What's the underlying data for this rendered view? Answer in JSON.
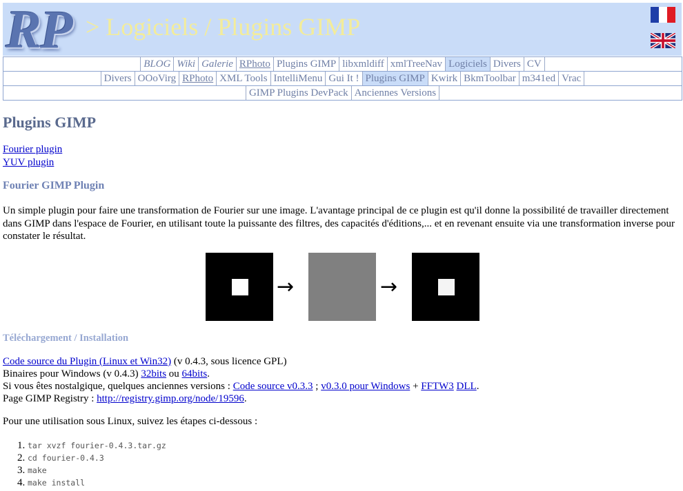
{
  "header": {
    "logo": "RP",
    "title": "> Logiciels / Plugins GIMP",
    "flags": [
      "flag-fr",
      "flag-uk"
    ],
    "colors": {
      "banner": "#c9dcf8",
      "title": "#f3ec9a",
      "logo": "#5a74b0"
    }
  },
  "nav": {
    "row1": [
      {
        "label": "BLOG",
        "italic": true
      },
      {
        "label": "Wiki",
        "italic": true
      },
      {
        "label": "Galerie",
        "italic": true
      },
      {
        "label": "RPhoto",
        "underline": true
      },
      {
        "label": "Plugins GIMP"
      },
      {
        "label": "libxmldiff"
      },
      {
        "label": "xmlTreeNav"
      },
      {
        "label": "Logiciels",
        "active": true
      },
      {
        "label": "Divers"
      },
      {
        "label": "CV"
      }
    ],
    "row2": [
      {
        "label": "Divers"
      },
      {
        "label": "OOoVirg"
      },
      {
        "label": "RPhoto",
        "underline": true
      },
      {
        "label": "XML Tools"
      },
      {
        "label": "IntelliMenu"
      },
      {
        "label": "Gui It !"
      },
      {
        "label": "Plugins GIMP",
        "active": true
      },
      {
        "label": "Kwirk"
      },
      {
        "label": "BkmToolbar"
      },
      {
        "label": "m341ed"
      },
      {
        "label": "Vrac"
      }
    ],
    "row3": [
      {
        "label": "GIMP Plugins DevPack"
      },
      {
        "label": "Anciennes Versions"
      }
    ]
  },
  "main": {
    "title": "Plugins GIMP",
    "toc": [
      "Fourier plugin",
      "YUV plugin"
    ],
    "section_title": "Fourier GIMP Plugin",
    "description": "Un simple plugin pour faire une transformation de Fourier sur une image. L'avantage principal de ce plugin est qu'il donne la possibilité de travailler directement dans GIMP dans l'espace de Fourier, en utilisant toute la puissante des filtres, des capacités d'éditions,... et en revenant ensuite via une transformation inverse pour constater le résultat.",
    "figure": {
      "arrow": "→",
      "colors": {
        "dark": "#000000",
        "mid": "#808080",
        "light": "#ffffff"
      }
    },
    "download_title": "Téléchargement / Installation",
    "download": {
      "src_link": "Code source du Plugin (Linux et Win32)",
      "src_text": " (v 0.4.3, sous licence GPL)",
      "bin_text": "Binaires pour Windows (v 0.4.3) ",
      "bin32": "32bits",
      "bin_or": " ou ",
      "bin64": "64bits",
      "bin_end": ".",
      "old_text": "Si vous êtes nostalgique, quelques anciennes versions : ",
      "old_src": "Code source v0.3.3",
      "old_sep": " ; ",
      "old_win": "v0.3.0 pour Windows",
      "old_plus": " + ",
      "fftw": "FFTW3",
      "dll": "DLL",
      "old_end": ".",
      "registry_text": "Page GIMP Registry : ",
      "registry_link": "http://registry.gimp.org/node/19596",
      "registry_end": "."
    },
    "linux_intro": "Pour une utilisation sous Linux, suivez les étapes ci-dessous :",
    "steps": [
      "tar xvzf fourier-0.4.3.tar.gz",
      "cd fourier-0.4.3",
      "make",
      "make install"
    ]
  }
}
